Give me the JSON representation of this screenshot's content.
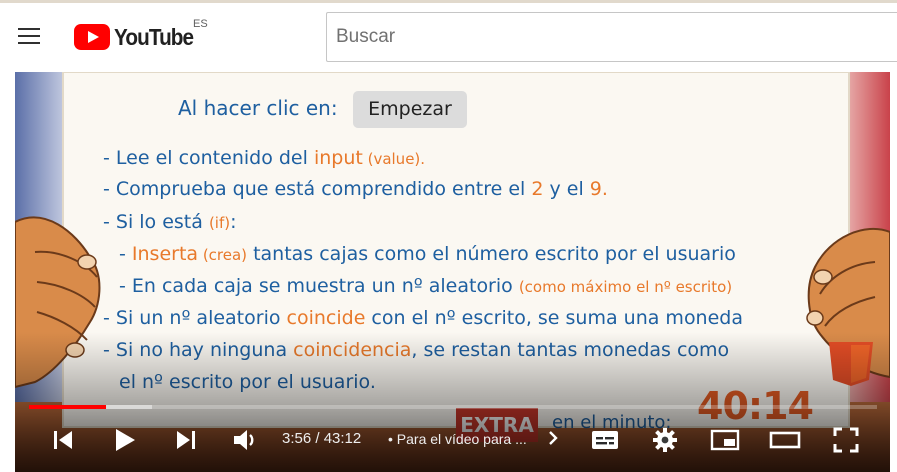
{
  "header": {
    "logo_text": "YouTube",
    "country_code": "ES",
    "search_placeholder": "Buscar"
  },
  "slide": {
    "line1_prefix": "Al hacer clic en:",
    "start_button": "Empezar",
    "line2_a": "- Lee el contenido del ",
    "line2_b": "input",
    "line2_c": " (value).",
    "line3_a": "- Comprueba que está comprendido entre el ",
    "line3_b": "2",
    "line3_c": " y el ",
    "line3_d": "9.",
    "line4_a": "- Si lo está ",
    "line4_b": " (if)",
    "line4_c": ":",
    "line5_a": "- ",
    "line5_b": "Inserta",
    "line5_c": " (crea)",
    "line5_d": " tantas cajas como el número escrito por el usuario",
    "line6_a": "- En cada caja se muestra un nº aleatorio ",
    "line6_b": "(como máximo el nº escrito)",
    "line7_a": "- Si un nº aleatorio ",
    "line7_b": "coincide",
    "line7_c": " con el nº escrito, se suma una moneda",
    "line8_a": "- Si no hay ninguna ",
    "line8_b": "coincidencia",
    "line8_c": ", se restan tantas monedas como",
    "line9": "el nº escrito por el usuario.",
    "badge_text": "EXTRA",
    "minute_text": "en  el minuto:",
    "minute_value": "40:14",
    "html5_badge": "5"
  },
  "player": {
    "current_time": "3:56 / 43:12",
    "chapter_separator": "•",
    "chapter_title": "Para el vídeo para ...",
    "played_fraction": 0.091,
    "buffered_fraction": 0.145
  },
  "icons": {
    "menu": "hamburger-icon",
    "prev": "previous-icon",
    "play": "play-icon",
    "next": "next-icon",
    "volume": "volume-icon",
    "subtitles": "subtitles-icon",
    "settings": "gear-icon",
    "miniplayer": "miniplayer-icon",
    "theater": "theater-mode-icon",
    "fullscreen": "fullscreen-icon"
  },
  "colors": {
    "brand_red": "#ff0000",
    "slide_blue": "#1e5fa0",
    "slide_orange": "#e8792b"
  }
}
